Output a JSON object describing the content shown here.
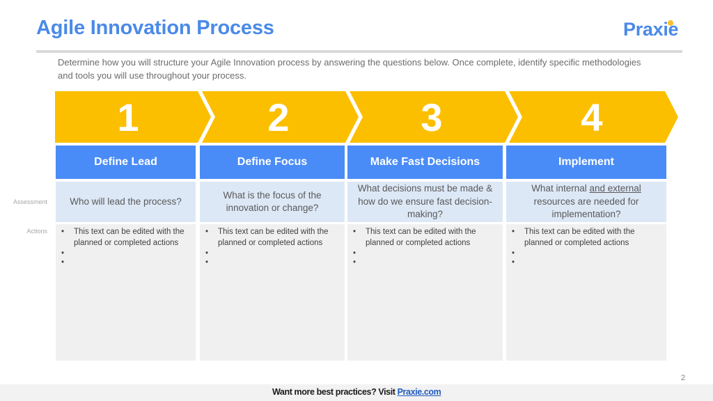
{
  "header": {
    "title": "Agile Innovation Process",
    "logo": "Praxie",
    "intro": "Determine how you will structure your Agile Innovation process by answering the questions below. Once complete, identify specific methodologies and tools you will use throughout your process."
  },
  "colors": {
    "title": "#4a8ae8",
    "chevron": "#fbbf00",
    "header_fill": "#4a8cf7",
    "assessment_fill": "#dde8f6",
    "actions_fill": "#f0f0f0"
  },
  "row_labels": {
    "assessment": "Assessment",
    "actions": "Actions"
  },
  "steps": [
    {
      "number": "1",
      "title": "Define Lead",
      "question": "Who will lead the process?",
      "actions": [
        "This text can be edited with the planned or completed actions",
        "",
        ""
      ]
    },
    {
      "number": "2",
      "title": "Define Focus",
      "question": "What is the focus of the innovation or change?",
      "actions": [
        "This text can be edited with the planned or completed actions",
        "",
        ""
      ]
    },
    {
      "number": "3",
      "title": "Make Fast Decisions",
      "question": "What decisions must be made & how do we ensure fast decision-making?",
      "actions": [
        "This text can be edited with the planned or completed actions",
        "",
        ""
      ]
    },
    {
      "number": "4",
      "title": "Implement",
      "question_before": "What internal ",
      "question_underlined": "and external",
      "question_after": " resources are needed for implementation?",
      "actions": [
        "This text can be edited with the planned or completed actions",
        "",
        ""
      ]
    }
  ],
  "page_number": "2",
  "footer": {
    "text": "Want more best practices? Visit ",
    "link": "Praxie.com"
  }
}
